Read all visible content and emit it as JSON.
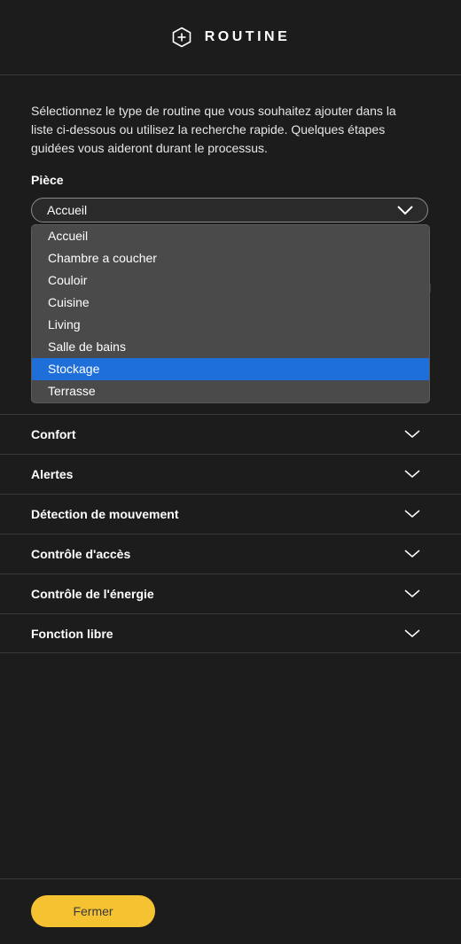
{
  "header": {
    "title": "ROUTINE",
    "icon": "plus-hexagon-icon"
  },
  "intro": {
    "text": "Sélectionnez le type de routine que vous souhaitez ajouter dans la liste ci-dessous ou utilisez la recherche rapide. Quelques étapes guidées vous aideront durant le processus."
  },
  "room_field": {
    "label": "Pièce",
    "selected_value": "Accueil",
    "options": [
      "Accueil",
      "Chambre a coucher",
      "Couloir",
      "Cuisine",
      "Living",
      "Salle de bains",
      "Stockage",
      "Terrasse"
    ],
    "highlighted_option": "Stockage"
  },
  "sections": [
    {
      "label": "Confort"
    },
    {
      "label": "Alertes"
    },
    {
      "label": "Détection de mouvement"
    },
    {
      "label": "Contrôle d'accès"
    },
    {
      "label": "Contrôle de l'énergie"
    },
    {
      "label": "Fonction libre"
    }
  ],
  "footer": {
    "close_label": "Fermer"
  },
  "colors": {
    "accent": "#f5c232",
    "highlight": "#1e6fd9",
    "background": "#1c1c1c"
  }
}
